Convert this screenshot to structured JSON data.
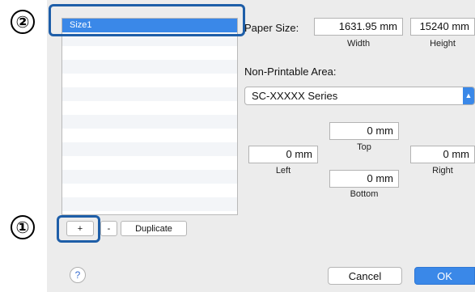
{
  "callouts": {
    "one": "①",
    "two": "②"
  },
  "list": {
    "items": [
      "Size1",
      "",
      "",
      "",
      "",
      "",
      "",
      "",
      "",
      "",
      "",
      "",
      "",
      ""
    ],
    "selected_index": 0
  },
  "list_buttons": {
    "add": "+",
    "remove": "-",
    "duplicate": "Duplicate"
  },
  "paper_size": {
    "label": "Paper Size:",
    "width_value": "1631.95 mm",
    "width_label": "Width",
    "height_value": "15240 mm",
    "height_label": "Height"
  },
  "non_printable": {
    "label": "Non-Printable Area:",
    "printer": "SC-XXXXX Series",
    "top_value": "0 mm",
    "top_label": "Top",
    "left_value": "0 mm",
    "left_label": "Left",
    "right_value": "0 mm",
    "right_label": "Right",
    "bottom_value": "0 mm",
    "bottom_label": "Bottom"
  },
  "footer": {
    "help": "?",
    "cancel": "Cancel",
    "ok": "OK"
  },
  "colors": {
    "accent": "#3a88e8",
    "highlight": "#1e5ea8"
  }
}
